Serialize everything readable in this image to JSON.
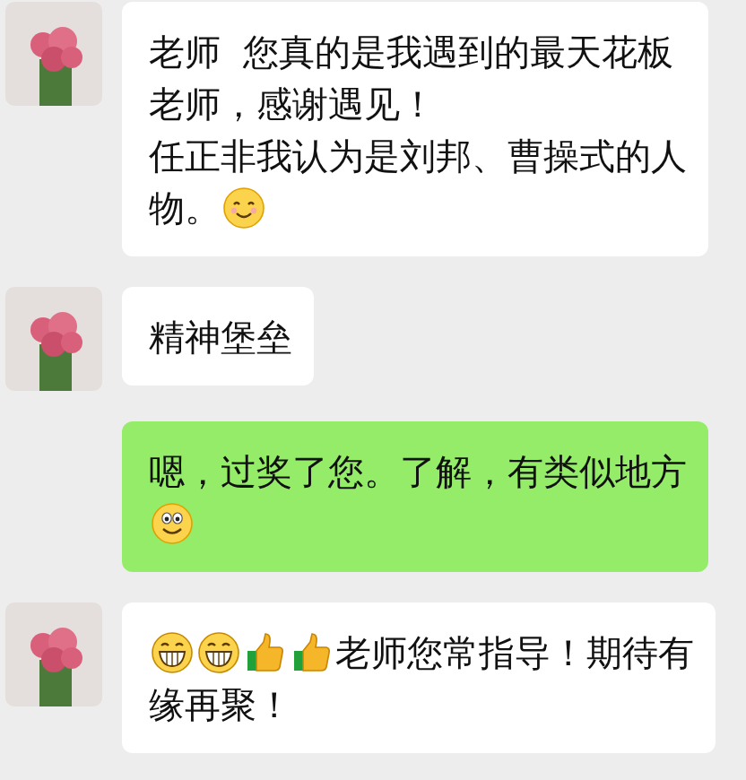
{
  "messages": [
    {
      "kind": "incoming",
      "lines": [
        [
          {
            "kind": "text",
            "text": "老师  您真的是我遇到的最天花板"
          }
        ],
        [
          {
            "kind": "text",
            "text": "老师，感谢遇见！"
          }
        ],
        [
          {
            "kind": "text",
            "text": "任正非我认为是刘邦、曹操式的人"
          }
        ],
        [
          {
            "kind": "text",
            "text": "物。"
          },
          {
            "kind": "smile"
          }
        ]
      ]
    },
    {
      "kind": "incoming",
      "lines": [
        [
          {
            "kind": "text",
            "text": "精神堡垒"
          }
        ]
      ]
    },
    {
      "kind": "outgoing",
      "lines": [
        [
          {
            "kind": "text",
            "text": "嗯，过奖了您。了解，有类似地方"
          }
        ],
        [
          {
            "kind": "goofy"
          }
        ]
      ]
    },
    {
      "kind": "incoming",
      "lines": [
        [
          {
            "kind": "grin"
          },
          {
            "kind": "grin"
          },
          {
            "kind": "thumbs"
          },
          {
            "kind": "thumbs"
          },
          {
            "kind": "text",
            "text": "老师您常指导！期待有"
          }
        ],
        [
          {
            "kind": "text",
            "text": "缘再聚！"
          }
        ]
      ]
    }
  ]
}
